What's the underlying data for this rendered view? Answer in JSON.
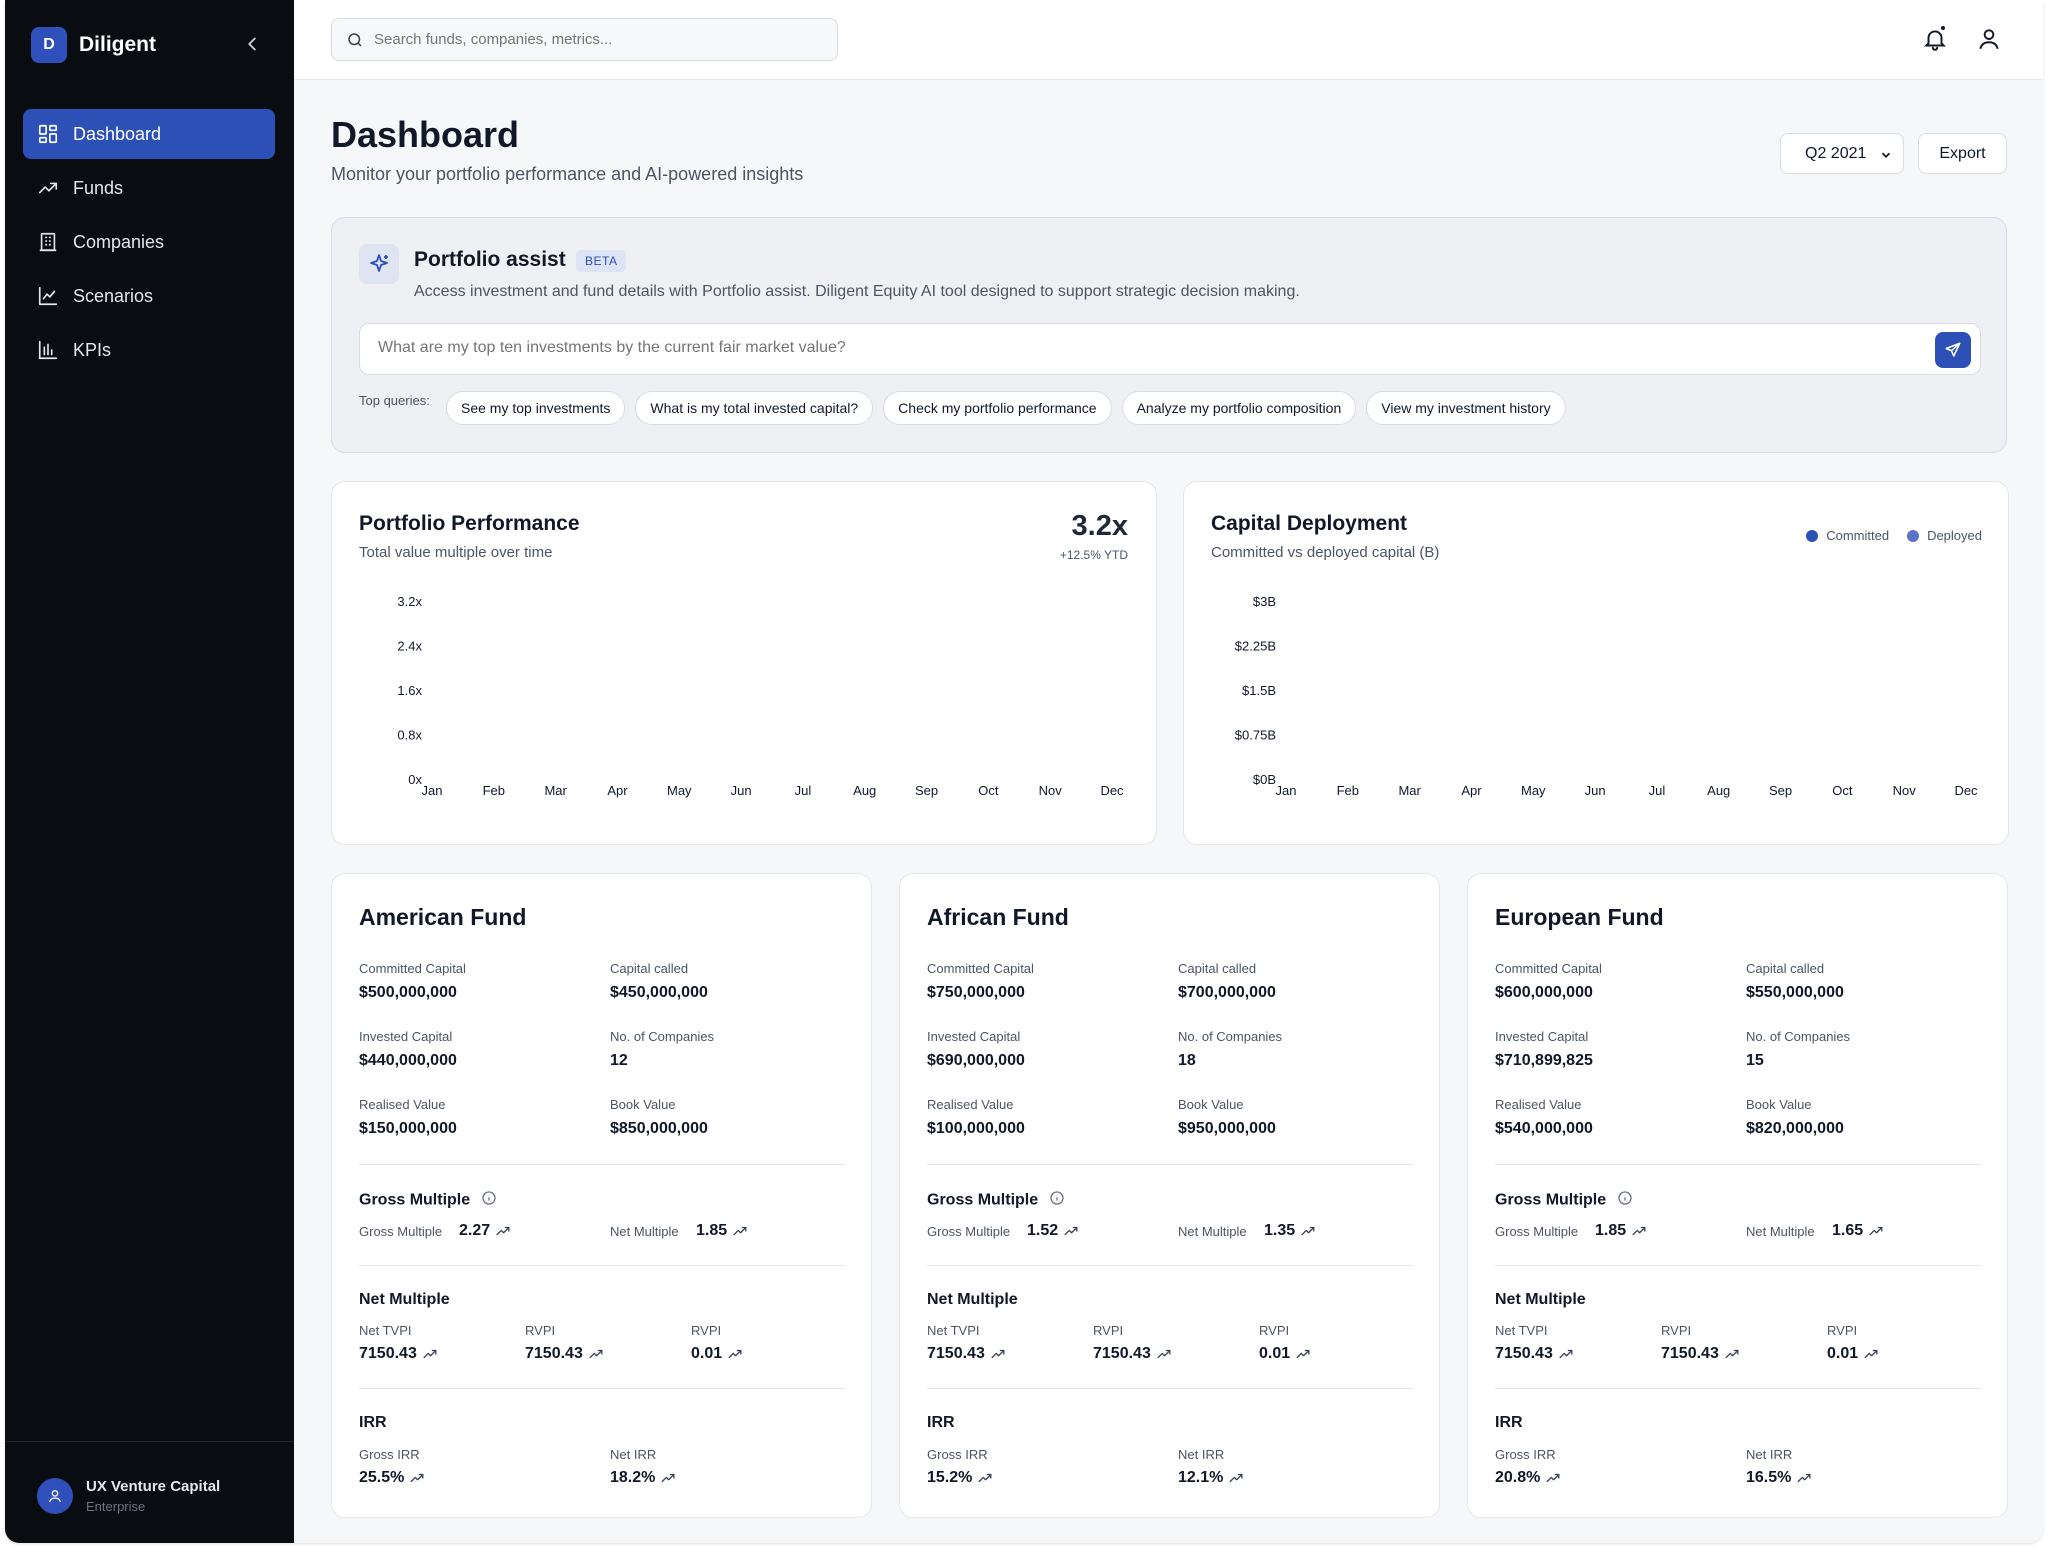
{
  "app": {
    "name": "Diligent",
    "logo_letter": "D"
  },
  "sidebar": {
    "items": [
      {
        "label": "Dashboard",
        "icon": "dashboard-icon",
        "active": true
      },
      {
        "label": "Funds",
        "icon": "trending-up-icon"
      },
      {
        "label": "Companies",
        "icon": "building-icon"
      },
      {
        "label": "Scenarios",
        "icon": "line-chart-icon"
      },
      {
        "label": "KPIs",
        "icon": "bar-chart-icon"
      }
    ],
    "footer": {
      "org": "UX Venture Capital",
      "plan": "Enterprise"
    }
  },
  "topbar": {
    "search_placeholder": "Search funds, companies, metrics..."
  },
  "page": {
    "title": "Dashboard",
    "subtitle": "Monitor your portfolio performance and AI-powered insights",
    "period": "Q2 2021",
    "export_label": "Export"
  },
  "assist": {
    "title": "Portfolio assist",
    "badge": "BETA",
    "description": "Access investment and fund details with Portfolio assist. Diligent Equity AI tool designed to support strategic decision making.",
    "placeholder": "What are my top ten investments by the current fair market value?",
    "top_queries_label": "Top queries:",
    "queries": [
      "See my top investments",
      "What is my total invested capital?",
      "Check my portfolio performance",
      "Analyze my portfolio composition",
      "View my investment history"
    ]
  },
  "colors": {
    "accent": "#2d50b6",
    "sidebar_bg": "#090c11",
    "committed": "#2d50b6",
    "deployed": "#5b74c9"
  },
  "chart_data": [
    {
      "type": "line",
      "title": "Portfolio Performance",
      "subtitle": "Total value multiple over time",
      "headline_value": "3.2x",
      "headline_delta": "+12.5% YTD",
      "categories": [
        "Jan",
        "Feb",
        "Mar",
        "Apr",
        "May",
        "Jun",
        "Jul",
        "Aug",
        "Sep",
        "Oct",
        "Nov",
        "Dec"
      ],
      "y_ticks": [
        "3.2x",
        "2.4x",
        "1.6x",
        "0.8x",
        "0x"
      ],
      "ylim": [
        0,
        3.2
      ],
      "series": []
    },
    {
      "type": "bar",
      "title": "Capital Deployment",
      "subtitle": "Committed vs deployed capital (B)",
      "categories": [
        "Jan",
        "Feb",
        "Mar",
        "Apr",
        "May",
        "Jun",
        "Jul",
        "Aug",
        "Sep",
        "Oct",
        "Nov",
        "Dec"
      ],
      "y_ticks": [
        "$3B",
        "$2.25B",
        "$1.5B",
        "$0.75B",
        "$0B"
      ],
      "ylim": [
        0,
        3
      ],
      "legend": [
        "Committed",
        "Deployed"
      ],
      "legend_position": "top-right",
      "series": []
    }
  ],
  "labels": {
    "committed": "Committed Capital",
    "called": "Capital called",
    "invested": "Invested Capital",
    "companies": "No. of Companies",
    "realised": "Realised Value",
    "book": "Book Value",
    "gross_multiple_section": "Gross Multiple",
    "gross_multiple": "Gross Multiple",
    "net_multiple": "Net Multiple",
    "net_multiple_section": "Net Multiple",
    "net_tvpi": "Net TVPI",
    "rvpi": "RVPI",
    "irr_section": "IRR",
    "gross_irr": "Gross IRR",
    "net_irr": "Net IRR"
  },
  "funds": [
    {
      "name": "American Fund",
      "committed": "$500,000,000",
      "called": "$450,000,000",
      "invested": "$440,000,000",
      "companies": "12",
      "realised": "$150,000,000",
      "book": "$850,000,000",
      "gross_multiple": "2.27",
      "net_multiple": "1.85",
      "net_tvpi": "7150.43",
      "rvpi_1": "7150.43",
      "rvpi_2": "0.01",
      "gross_irr": "25.5%",
      "net_irr": "18.2%"
    },
    {
      "name": "African Fund",
      "committed": "$750,000,000",
      "called": "$700,000,000",
      "invested": "$690,000,000",
      "companies": "18",
      "realised": "$100,000,000",
      "book": "$950,000,000",
      "gross_multiple": "1.52",
      "net_multiple": "1.35",
      "net_tvpi": "7150.43",
      "rvpi_1": "7150.43",
      "rvpi_2": "0.01",
      "gross_irr": "15.2%",
      "net_irr": "12.1%"
    },
    {
      "name": "European Fund",
      "committed": "$600,000,000",
      "called": "$550,000,000",
      "invested": "$710,899,825",
      "companies": "15",
      "realised": "$540,000,000",
      "book": "$820,000,000",
      "gross_multiple": "1.85",
      "net_multiple": "1.65",
      "net_tvpi": "7150.43",
      "rvpi_1": "7150.43",
      "rvpi_2": "0.01",
      "gross_irr": "20.8%",
      "net_irr": "16.5%"
    }
  ]
}
